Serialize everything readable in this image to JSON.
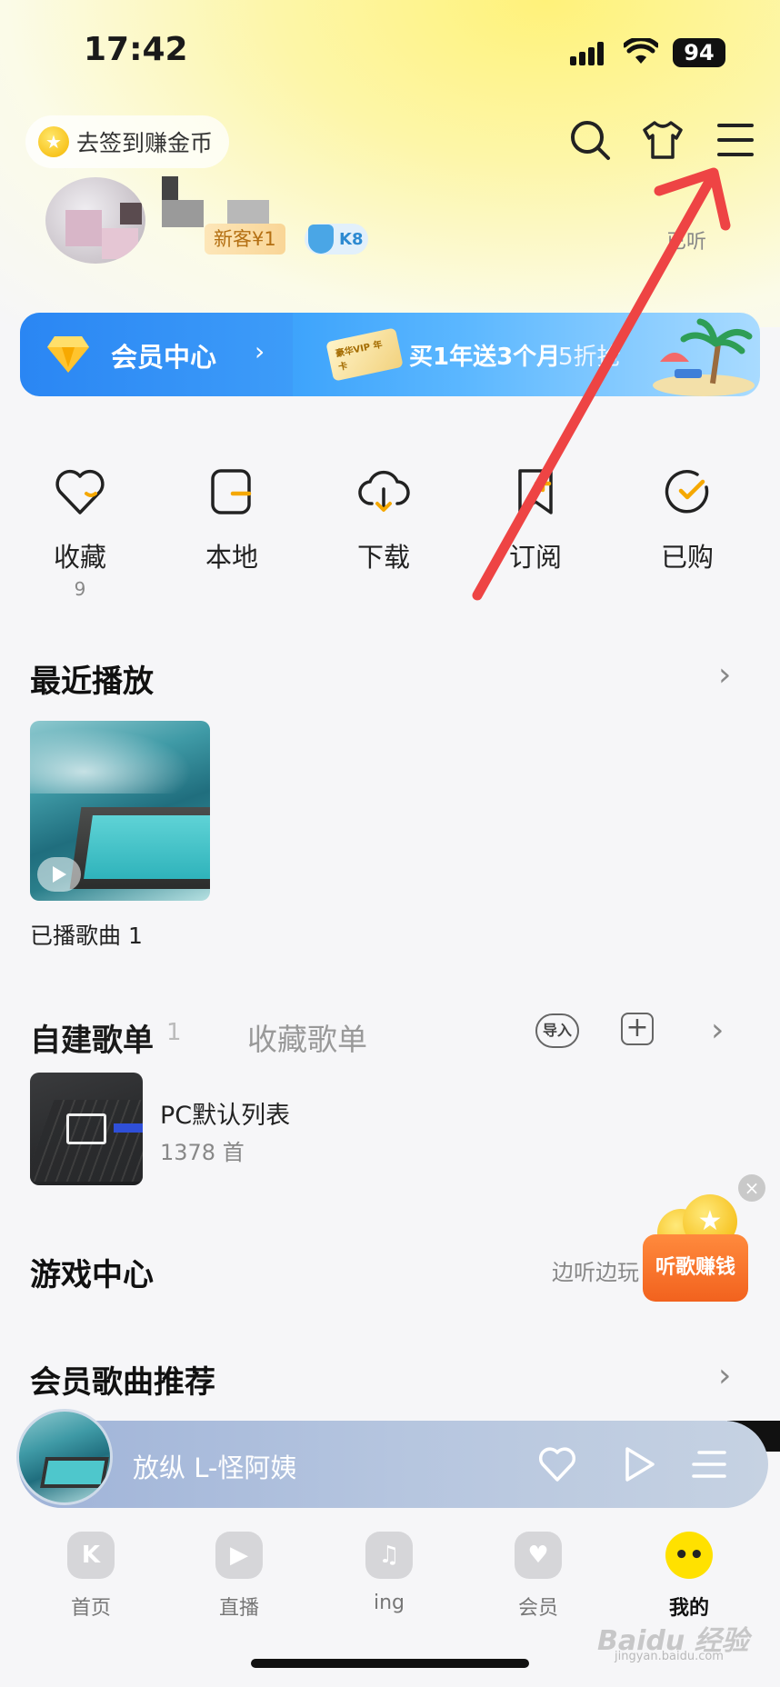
{
  "status_bar": {
    "time": "17:42",
    "battery": "94"
  },
  "header": {
    "sign_in_label": "去签到赚金币"
  },
  "profile": {
    "newbie_badge": "新客¥1",
    "level": "K8",
    "listened_label": "已听"
  },
  "vip_banner": {
    "title": "会员中心",
    "card_text": "豪华VIP 年卡",
    "promo": "买1年送3个月",
    "discount": "5折抢"
  },
  "quick_actions": [
    {
      "label": "收藏",
      "count": "9"
    },
    {
      "label": "本地"
    },
    {
      "label": "下载"
    },
    {
      "label": "订阅"
    },
    {
      "label": "已购"
    }
  ],
  "recent": {
    "title": "最近播放",
    "item_label": "已播歌曲 1"
  },
  "playlists": {
    "tab_active": "自建歌单",
    "tab_count": "1",
    "tab_inactive": "收藏歌单",
    "import_label": "导入",
    "add_label": "+",
    "items": [
      {
        "name": "PC默认列表",
        "count": "1378 首"
      }
    ]
  },
  "game_center": {
    "title": "游戏中心",
    "subtitle": "边听边玩"
  },
  "earn_badge": {
    "label": "听歌赚钱"
  },
  "vip_songs": {
    "title": "会员歌曲推荐"
  },
  "player": {
    "title": "放纵 L-怪阿姨"
  },
  "nav": [
    {
      "label": "首页",
      "icon": "K"
    },
    {
      "label": "直播",
      "icon": "▶"
    },
    {
      "label": "ing",
      "icon": "♫"
    },
    {
      "label": "会员",
      "icon": "♥"
    },
    {
      "label": "我的",
      "icon": "••"
    }
  ],
  "watermark": {
    "brand": "Baidu 经验",
    "url": "jingyan.baidu.com"
  },
  "colors": {
    "accent": "#ffe100",
    "annotation": "#ee4444",
    "vip_blue": "#2c8cf5"
  }
}
